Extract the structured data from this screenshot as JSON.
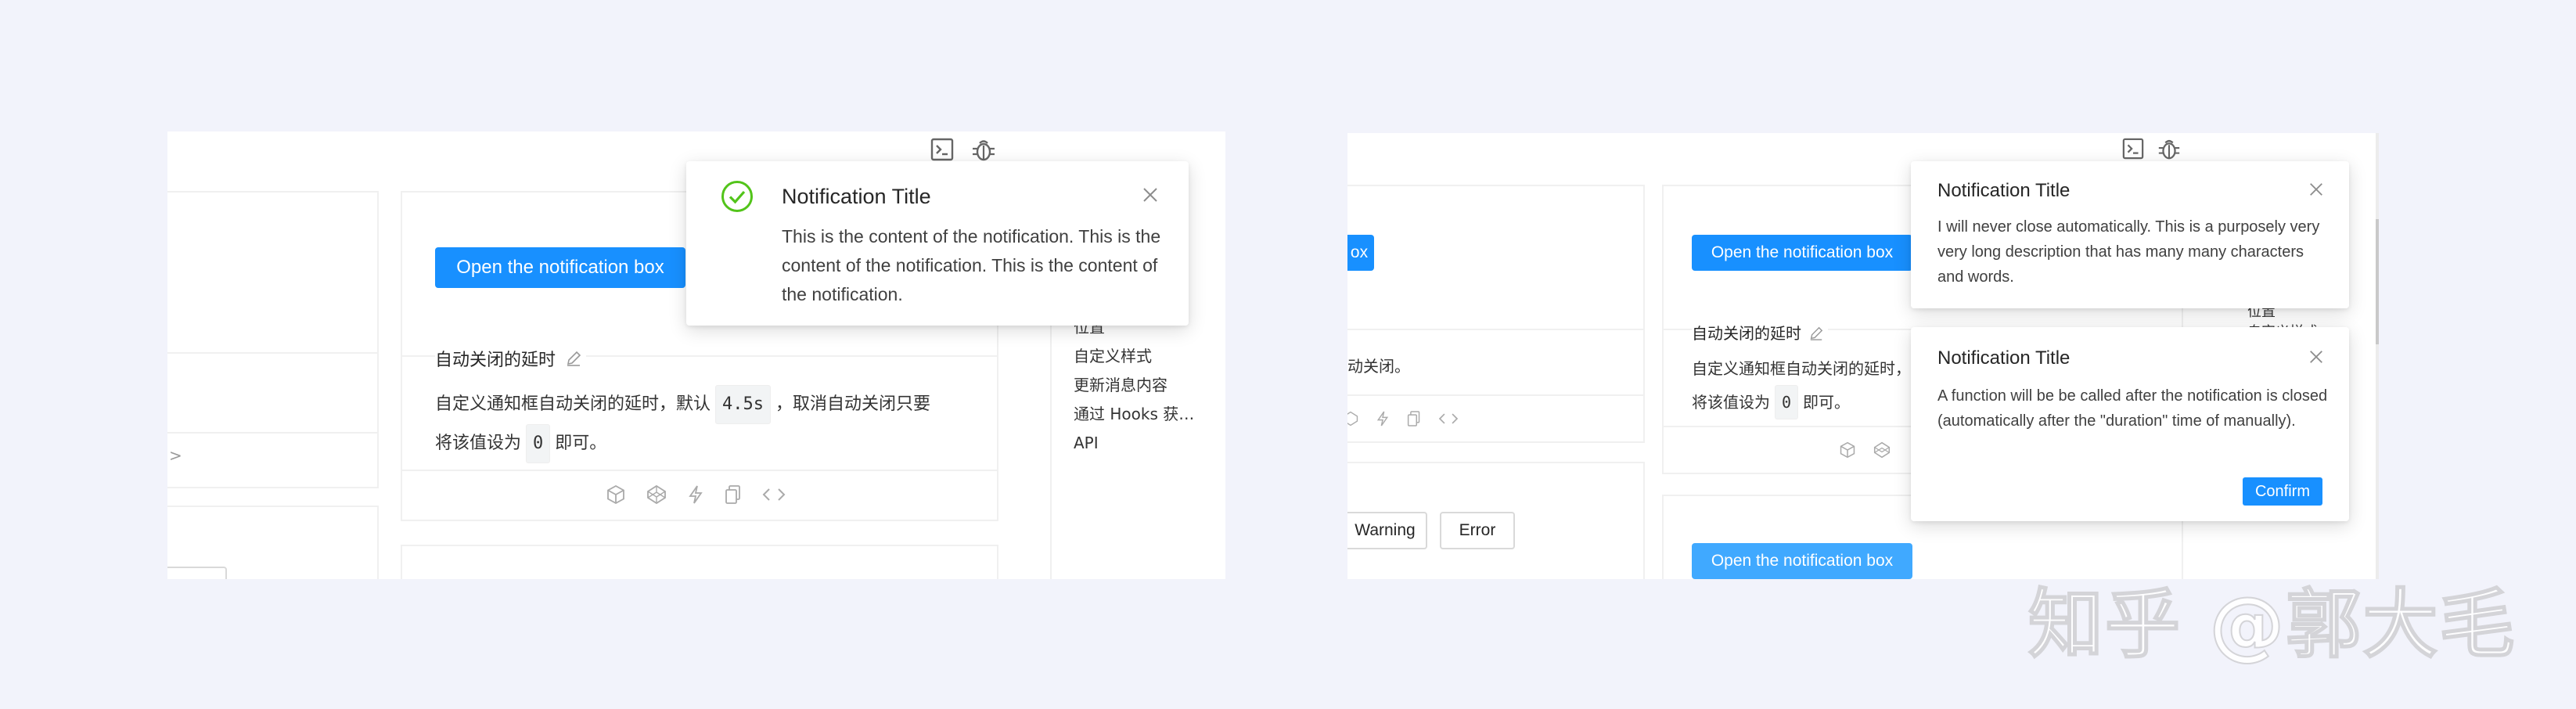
{
  "left": {
    "open_button": "Open the notification box",
    "section_title": "自动关闭的延时",
    "desc_part1": "自定义通知框自动关闭的延时，默认",
    "code_duration": "4.5s",
    "desc_part2": "，取消自动关闭只要",
    "desc_line2_part1": "将该值设为",
    "code_zero": "0",
    "desc_line2_part2": "即可。",
    "anchors": [
      "位置",
      "自定义样式",
      "更新消息内容",
      "通过 Hooks 获…",
      "API"
    ],
    "chevron": ">",
    "notification": {
      "title": "Notification Title",
      "description": "This is the content of the notification. This is the content of the notification. This is the content of the notification.",
      "icon": "check-circle-icon",
      "icon_color": "#52c41a"
    }
  },
  "right": {
    "partial_button": "ox",
    "open_button": "Open the notification box",
    "open_button_2": "Open the notification box",
    "section_title": "自动关闭的延时",
    "desc_part1": "自定义通知框自动关闭的延时，",
    "desc_line2_part1": "将该值设为",
    "code_zero": "0",
    "desc_line2_part2": "即可。",
    "left_desc_tail": "动关闭。",
    "warning_button": "Warning",
    "error_button": "Error",
    "anchor_partial_1": "位置",
    "anchor_partial_2": "自定义样式",
    "notification_1": {
      "title": "Notification Title",
      "description": "I will never close automatically. This is a purposely very very long description that has many many characters and words."
    },
    "notification_2": {
      "title": "Notification Title",
      "description": "A function will be be called after the notification is closed (automatically after the \"duration\" time of manually).",
      "confirm_button": "Confirm"
    }
  },
  "watermark": "知乎 @郭大毛",
  "colors": {
    "primary": "#1890ff",
    "success": "#52c41a",
    "background": "#f2f3fb"
  }
}
